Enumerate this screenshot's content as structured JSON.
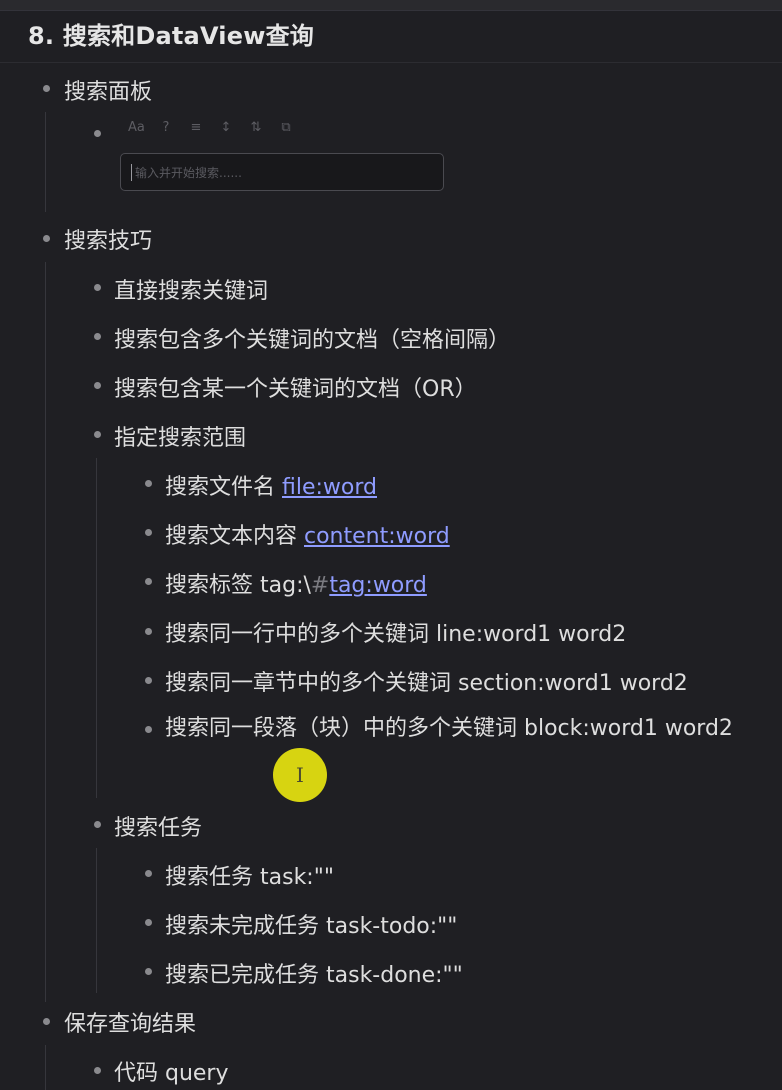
{
  "heading": "8. 搜索和DataView查询",
  "search_panel": {
    "toolbar_icons": [
      "Aa",
      "?",
      "≡",
      "↕",
      "⇅",
      "⧉"
    ],
    "placeholder": "输入并开始搜索......"
  },
  "items": {
    "panel": "搜索面板",
    "tips": "搜索技巧",
    "direct": "直接搜索关键词",
    "multi": "搜索包含多个关键词的文档（空格间隔）",
    "or": "搜索包含某一个关键词的文档（OR）",
    "scope": "指定搜索范围",
    "file_label": "搜索文件名 ",
    "file_link": "file:word",
    "content_label": "搜索文本内容 ",
    "content_link": "content:word",
    "tag_label": "搜索标签 tag:\\",
    "tag_hash": "#",
    "tag_link": "tag:word",
    "line": "搜索同一行中的多个关键词 line:word1 word2",
    "section": "搜索同一章节中的多个关键词 section:word1 word2",
    "block": "搜索同一段落（块）中的多个关键词 block:word1 word2",
    "tasks": "搜索任务",
    "task_all": "搜索任务 task:\"\"",
    "task_todo": "搜索未完成任务 task-todo:\"\"",
    "task_done": "搜索已完成任务 task-done:\"\"",
    "save": "保存查询结果",
    "code": "代码 query"
  },
  "colors": {
    "background": "#1f1f23",
    "text": "#dedede",
    "link": "#8f9cff",
    "cursor_highlight": "#e7e410"
  }
}
